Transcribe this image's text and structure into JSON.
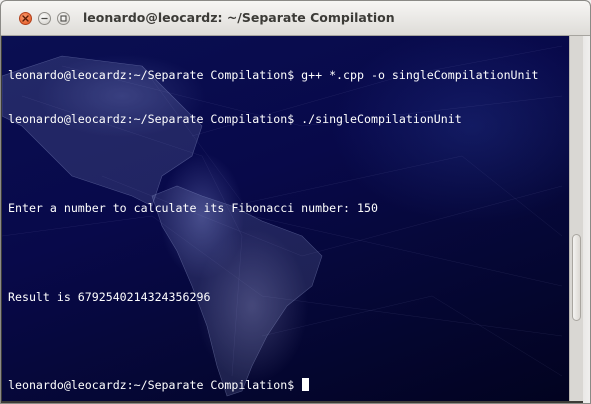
{
  "window": {
    "title": "leonardo@leocardz: ~/Separate Compilation",
    "buttons": {
      "close": "close-icon",
      "minimize": "minimize-icon",
      "maximize": "maximize-icon"
    },
    "colors": {
      "close": "#e0531f",
      "terminal_bg": "#070a45",
      "text": "#ffffff"
    }
  },
  "terminal": {
    "lines": [
      "leonardo@leocardz:~/Separate Compilation$ g++ *.cpp -o singleCompilationUnit",
      "leonardo@leocardz:~/Separate Compilation$ ./singleCompilationUnit",
      "",
      "Enter a number to calculate its Fibonacci number: 150",
      "",
      "Result is 6792540214324356296",
      "",
      "leonardo@leocardz:~/Separate Compilation$ "
    ]
  }
}
